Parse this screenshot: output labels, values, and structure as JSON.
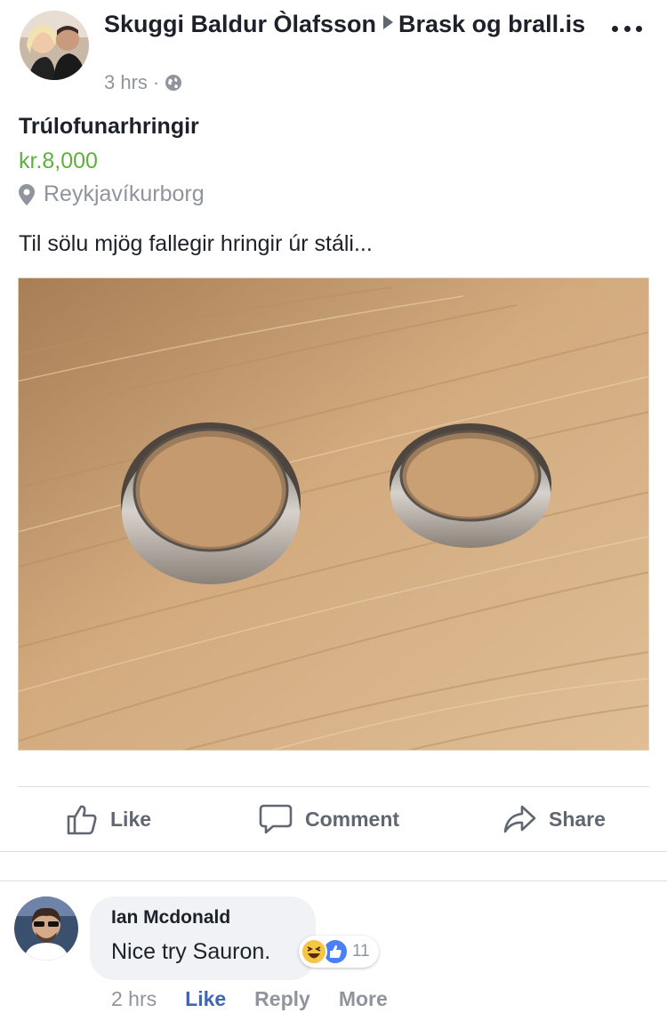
{
  "post": {
    "author": "Skuggi Baldur Òlafsson",
    "group": "Brask og brall.is",
    "time": "3 hrs",
    "separator": "·",
    "privacy_icon": "globe-icon",
    "menu_icon": "more-horizontal-icon"
  },
  "listing": {
    "title": "Trúlofunarhringir",
    "price": "kr.8,000",
    "location": "Reykjavíkurborg",
    "location_icon": "map-pin-icon",
    "description": "Til sölu mjög fallegir hringir úr stáli..."
  },
  "actions": {
    "like": "Like",
    "comment": "Comment",
    "share": "Share"
  },
  "comment": {
    "author": "Ian Mcdonald",
    "text": "Nice try Sauron.",
    "reactions": [
      "haha-icon",
      "like-icon"
    ],
    "reaction_count": "11",
    "time": "2 hrs",
    "like": "Like",
    "reply": "Reply",
    "more": "More"
  },
  "colors": {
    "price_green": "#5fb03f",
    "link_blue": "#4267b2",
    "secondary_text": "#90949c"
  }
}
